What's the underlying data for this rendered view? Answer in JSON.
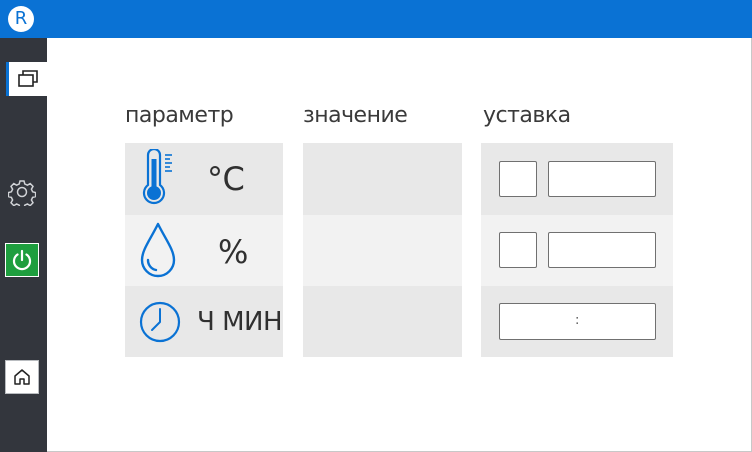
{
  "app": {
    "logo_letter": "R",
    "accent": "#0a72d4",
    "sidebar_color": "#33363d",
    "power_color": "#1e9e3e"
  },
  "sidebar": [
    {
      "name": "windows-icon",
      "active": true
    },
    {
      "name": "gear-icon"
    },
    {
      "name": "power-icon"
    },
    {
      "name": "home-icon"
    }
  ],
  "table": {
    "headers": {
      "param": "параметр",
      "value": "значение",
      "setpoint": "уставка"
    },
    "rows": [
      {
        "icon": "thermometer-icon",
        "unit": "°C",
        "value": "",
        "setpoint_small": "",
        "setpoint_large": ""
      },
      {
        "icon": "droplet-icon",
        "unit": "%",
        "value": "",
        "setpoint_small": "",
        "setpoint_large": ""
      },
      {
        "icon": "clock-icon",
        "unit": "Ч МИН",
        "value": "",
        "setpoint_time": ":"
      }
    ]
  }
}
